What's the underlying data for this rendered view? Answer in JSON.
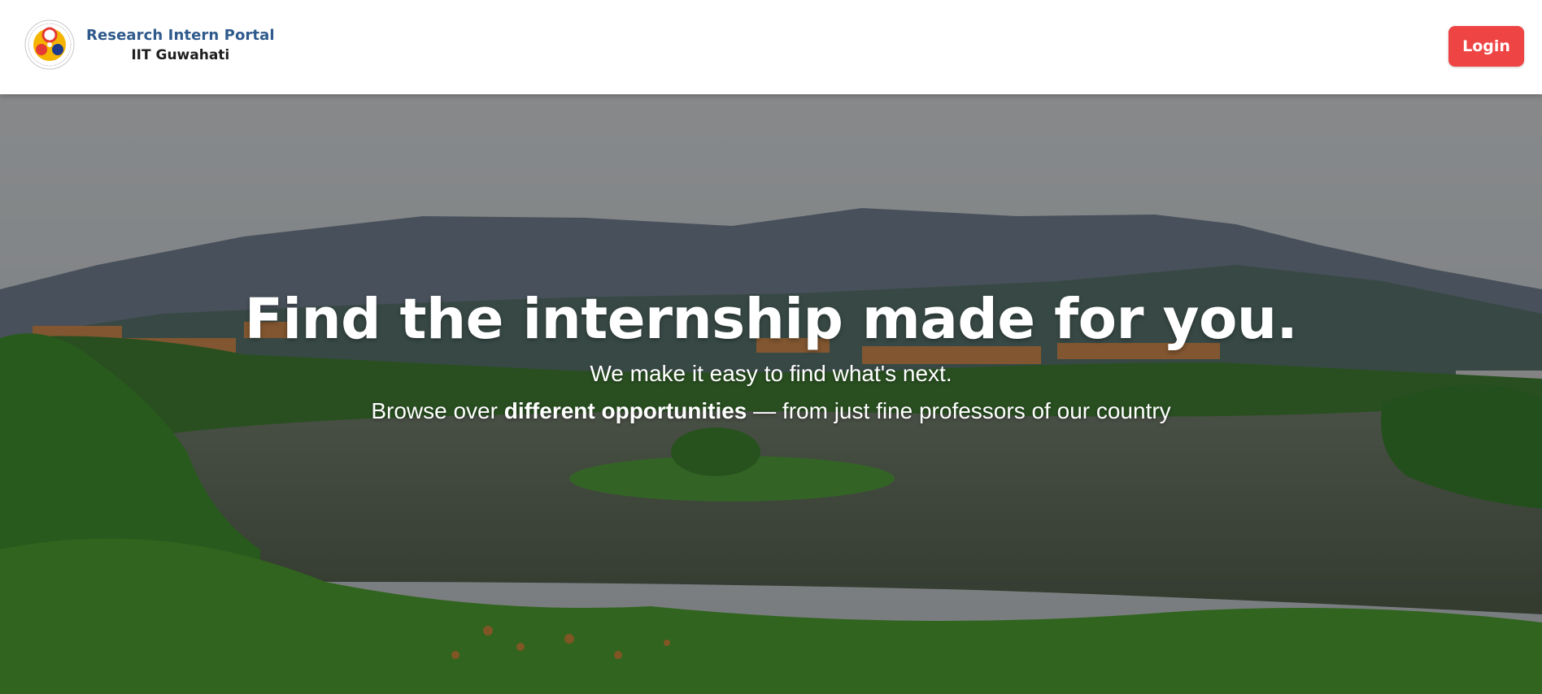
{
  "header": {
    "brand_title": "Research Intern Portal",
    "brand_subtitle": "IIT Guwahati",
    "logo_icon": "iit-guwahati-emblem-icon",
    "login_label": "Login"
  },
  "hero": {
    "headline": "Find the internship made for you.",
    "tagline": "We make it easy to find what's next.",
    "browse_prefix": "Browse over ",
    "browse_bold": "different opportunities",
    "browse_suffix": " — from just fine professors of our country"
  },
  "colors": {
    "accent": "#ef4444",
    "brand_blue": "#2f5a8c",
    "overlay": "rgba(0,0,0,0.35)"
  }
}
